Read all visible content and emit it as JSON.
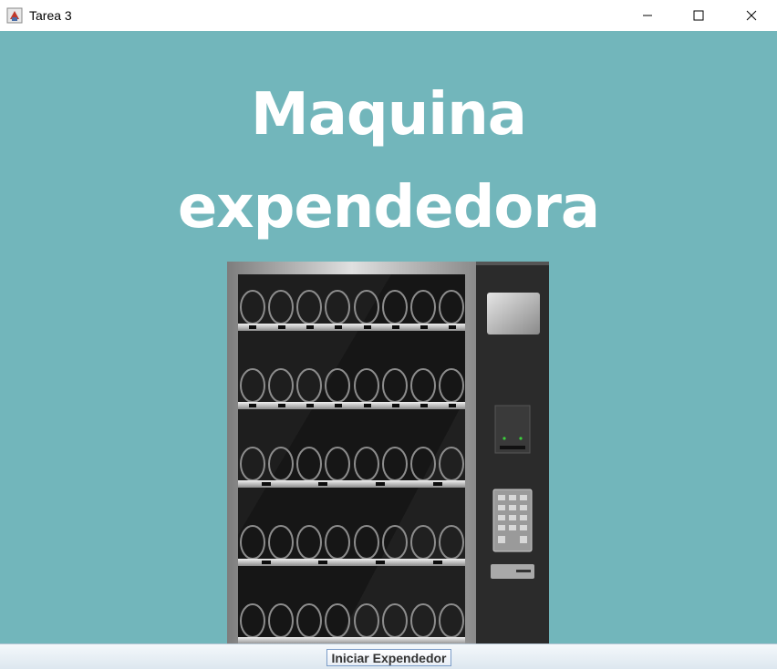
{
  "window": {
    "title": "Tarea 3",
    "icons": {
      "app": "java-app-icon",
      "minimize": "minimize-icon",
      "maximize": "maximize-icon",
      "close": "close-icon"
    }
  },
  "main": {
    "heading_line1": "Maquina",
    "heading_line2": "expendedora",
    "background_color": "#72b6bb",
    "illustration": "vending-machine-illustration"
  },
  "footer": {
    "start_button_label": "Iniciar Expendedor"
  }
}
